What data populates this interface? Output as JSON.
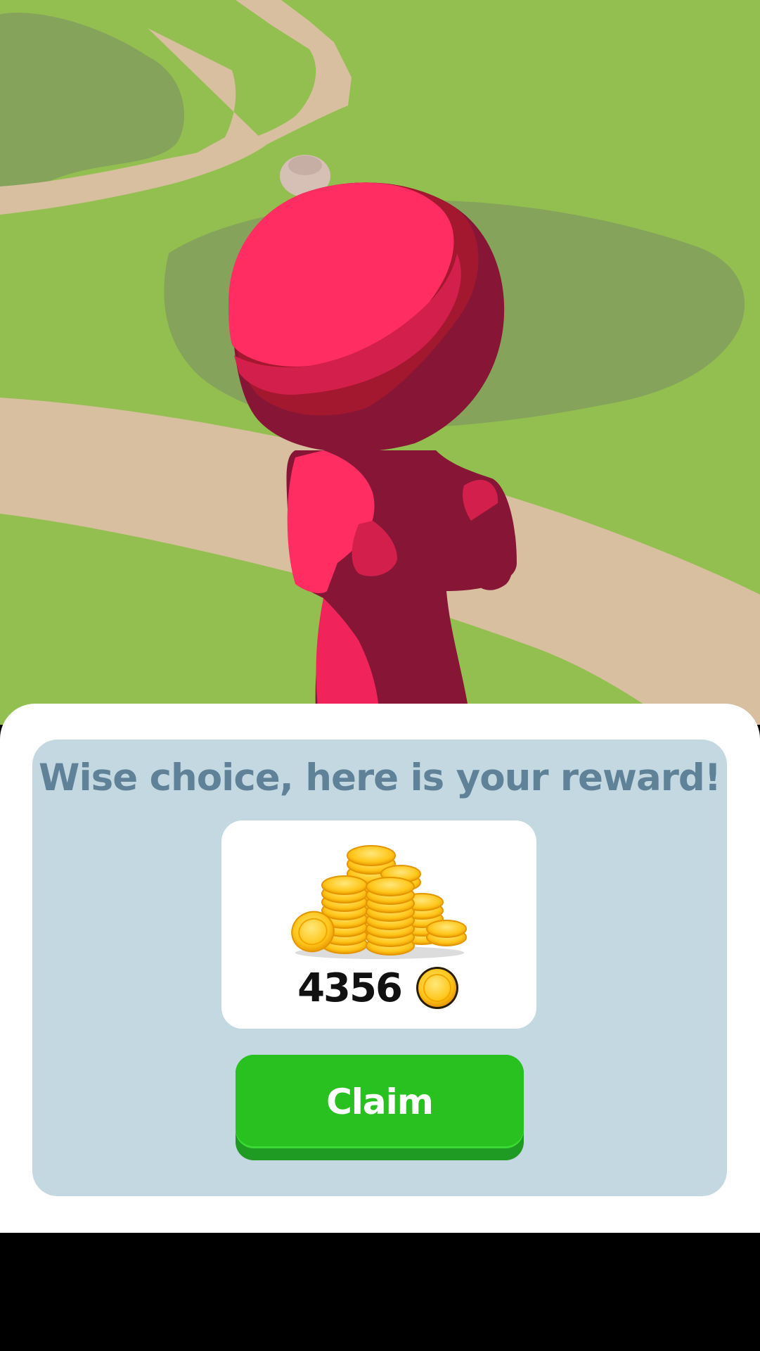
{
  "colors": {
    "grass": "#93bf50",
    "grass_shadow": "#86a35b",
    "path": "#d8bf9f",
    "character_light": "#ff2d62",
    "character_mid": "#d31f4b",
    "character_dark": "#871636",
    "panel_inner": "#c3d8e0",
    "title_text": "#5f8299",
    "claim_green": "#28c11f",
    "coin_gold": "#ffc61a"
  },
  "reward_popup": {
    "title": "Wise choice, here is your reward!",
    "reward_amount": "4356",
    "reward_icon": "gold-coin-icon",
    "reward_image": "coin-pile-icon",
    "claim_label": "Claim"
  }
}
